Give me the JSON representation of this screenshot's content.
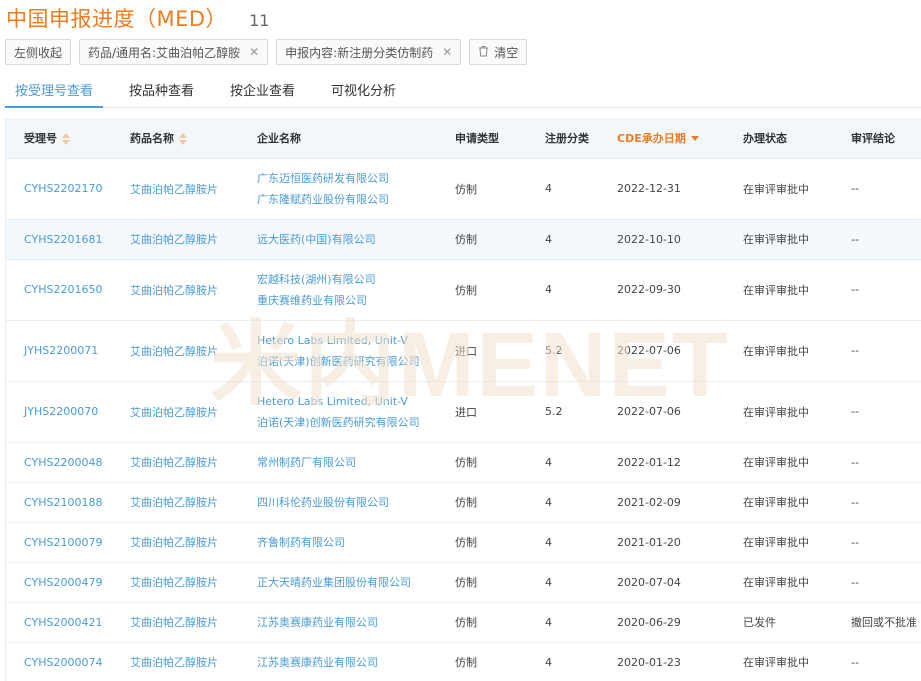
{
  "page": {
    "title": "中国申报进度（MED）",
    "count": "11"
  },
  "filters": {
    "collapse_label": "左侧收起",
    "chips": [
      {
        "label": "药品/通用名:艾曲泊帕乙醇胺"
      },
      {
        "label": "申报内容:新注册分类仿制药"
      }
    ],
    "clear_label": "清空"
  },
  "tabs": [
    {
      "label": "按受理号查看",
      "active": true
    },
    {
      "label": "按品种查看",
      "active": false
    },
    {
      "label": "按企业查看",
      "active": false
    },
    {
      "label": "可视化分析",
      "active": false
    }
  ],
  "table": {
    "headers": {
      "accept_no": "受理号",
      "drug_name": "药品名称",
      "company": "企业名称",
      "apply_type": "申请类型",
      "reg_class": "注册分类",
      "cde_date": "CDE承办日期",
      "status": "办理状态",
      "conclusion": "审评结论"
    },
    "rows": [
      {
        "accept_no": "CYHS2202170",
        "drug_name": "艾曲泊帕乙醇胺片",
        "companies": [
          "广东迈恒医药研发有限公司",
          "广东隆赋药业股份有限公司"
        ],
        "apply_type": "仿制",
        "reg_class": "4",
        "cde_date": "2022-12-31",
        "status": "在审评审批中",
        "conclusion": "--"
      },
      {
        "accept_no": "CYHS2201681",
        "drug_name": "艾曲泊帕乙醇胺片",
        "companies": [
          "远大医药(中国)有限公司"
        ],
        "apply_type": "仿制",
        "reg_class": "4",
        "cde_date": "2022-10-10",
        "status": "在审评审批中",
        "conclusion": "--"
      },
      {
        "accept_no": "CYHS2201650",
        "drug_name": "艾曲泊帕乙醇胺片",
        "companies": [
          "宏越科技(湖州)有限公司",
          "重庆赛维药业有限公司"
        ],
        "apply_type": "仿制",
        "reg_class": "4",
        "cde_date": "2022-09-30",
        "status": "在审评审批中",
        "conclusion": "--"
      },
      {
        "accept_no": "JYHS2200071",
        "drug_name": "艾曲泊帕乙醇胺片",
        "companies": [
          "Hetero Labs Limited, Unit-V",
          "泊诺(天津)创新医药研究有限公司"
        ],
        "apply_type": "进口",
        "reg_class": "5.2",
        "cde_date": "2022-07-06",
        "status": "在审评审批中",
        "conclusion": "--"
      },
      {
        "accept_no": "JYHS2200070",
        "drug_name": "艾曲泊帕乙醇胺片",
        "companies": [
          "Hetero Labs Limited, Unit-V",
          "泊诺(天津)创新医药研究有限公司"
        ],
        "apply_type": "进口",
        "reg_class": "5.2",
        "cde_date": "2022-07-06",
        "status": "在审评审批中",
        "conclusion": "--"
      },
      {
        "accept_no": "CYHS2200048",
        "drug_name": "艾曲泊帕乙醇胺片",
        "companies": [
          "常州制药厂有限公司"
        ],
        "apply_type": "仿制",
        "reg_class": "4",
        "cde_date": "2022-01-12",
        "status": "在审评审批中",
        "conclusion": "--"
      },
      {
        "accept_no": "CYHS2100188",
        "drug_name": "艾曲泊帕乙醇胺片",
        "companies": [
          "四川科伦药业股份有限公司"
        ],
        "apply_type": "仿制",
        "reg_class": "4",
        "cde_date": "2021-02-09",
        "status": "在审评审批中",
        "conclusion": "--"
      },
      {
        "accept_no": "CYHS2100079",
        "drug_name": "艾曲泊帕乙醇胺片",
        "companies": [
          "齐鲁制药有限公司"
        ],
        "apply_type": "仿制",
        "reg_class": "4",
        "cde_date": "2021-01-20",
        "status": "在审评审批中",
        "conclusion": "--"
      },
      {
        "accept_no": "CYHS2000479",
        "drug_name": "艾曲泊帕乙醇胺片",
        "companies": [
          "正大天晴药业集团股份有限公司"
        ],
        "apply_type": "仿制",
        "reg_class": "4",
        "cde_date": "2020-07-04",
        "status": "在审评审批中",
        "conclusion": "--"
      },
      {
        "accept_no": "CYHS2000421",
        "drug_name": "艾曲泊帕乙醇胺片",
        "companies": [
          "江苏奥赛康药业有限公司"
        ],
        "apply_type": "仿制",
        "reg_class": "4",
        "cde_date": "2020-06-29",
        "status": "已发件",
        "conclusion": "撤回或不批准"
      },
      {
        "accept_no": "CYHS2000074",
        "drug_name": "艾曲泊帕乙醇胺片",
        "companies": [
          "江苏奥赛康药业有限公司"
        ],
        "apply_type": "仿制",
        "reg_class": "4",
        "cde_date": "2020-01-23",
        "status": "在审评审批中",
        "conclusion": "--"
      }
    ]
  },
  "watermark": "米内MENET",
  "colors": {
    "accent": "#f07c1e",
    "link": "#4a9bd6",
    "header_bg": "#f2f7fb"
  }
}
